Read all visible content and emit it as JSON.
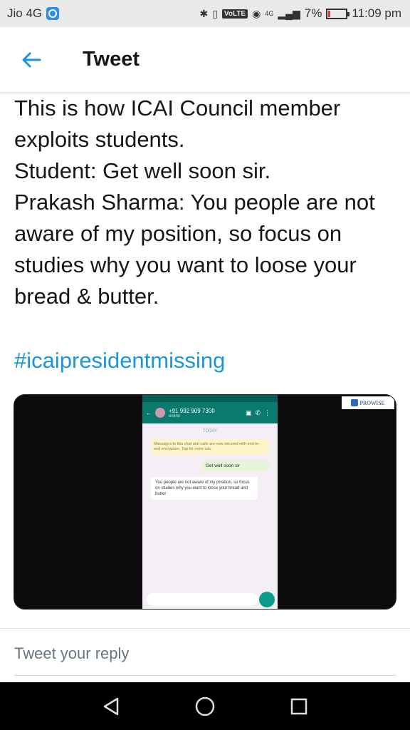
{
  "status_bar": {
    "carrier": "Jio 4G",
    "volte": "VoLTE",
    "network": "4G",
    "battery": "7%",
    "time": "11:09 pm"
  },
  "header": {
    "title": "Tweet"
  },
  "tweet": {
    "text": "This is how ICAI Council member exploits students.\nStudent: Get well soon sir.\nPrakash Sharma: You people are not aware of my position, so focus on studies why you want to loose your bread & butter.",
    "hashtag": "#icaipresidentmissing"
  },
  "media": {
    "contact": "+91 992 909 7300",
    "contact_status": "online",
    "day_label": "TODAY",
    "notice": "Messages to this chat and calls are now secured with end-to-end encryption. Tap for more info.",
    "outgoing_message": "Get well soon sir",
    "incoming_message": "You people are not aware of my position, so focus on studies why you want to loose your bread and butter",
    "watermark": "PROWISE"
  },
  "reply": {
    "placeholder": "Tweet your reply"
  },
  "colors": {
    "accent": "#1b95e0",
    "text": "#14171a",
    "muted": "#657786"
  }
}
